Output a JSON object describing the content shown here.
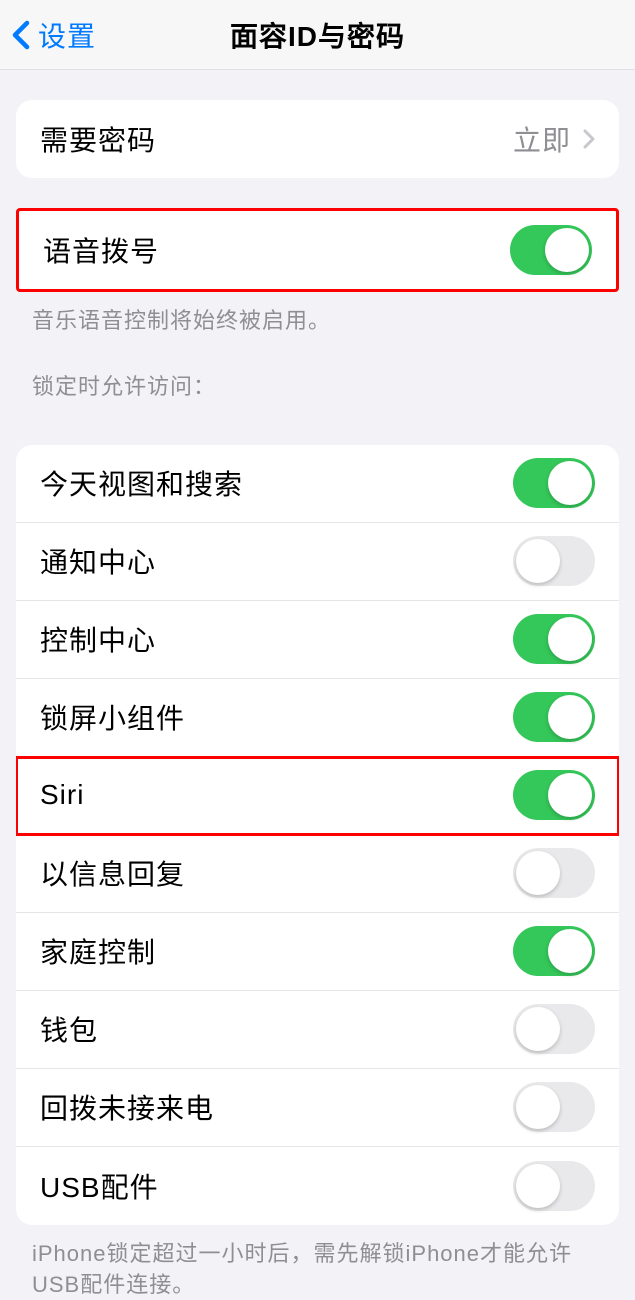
{
  "nav": {
    "back_label": "设置",
    "title": "面容ID与密码"
  },
  "require_passcode": {
    "label": "需要密码",
    "value": "立即"
  },
  "voice_dial": {
    "label": "语音拨号",
    "enabled": true
  },
  "voice_dial_footer": "音乐语音控制将始终被启用。",
  "lock_access_header": "锁定时允许访问：",
  "lock_access_items": [
    {
      "label": "今天视图和搜索",
      "enabled": true
    },
    {
      "label": "通知中心",
      "enabled": false
    },
    {
      "label": "控制中心",
      "enabled": true
    },
    {
      "label": "锁屏小组件",
      "enabled": true
    },
    {
      "label": "Siri",
      "enabled": true
    },
    {
      "label": "以信息回复",
      "enabled": false
    },
    {
      "label": "家庭控制",
      "enabled": true
    },
    {
      "label": "钱包",
      "enabled": false
    },
    {
      "label": "回拨未接来电",
      "enabled": false
    },
    {
      "label": "USB配件",
      "enabled": false
    }
  ],
  "usb_footer": "iPhone锁定超过一小时后，需先解锁iPhone才能允许USB配件连接。",
  "highlights": {
    "voice_dial_group": true,
    "siri_row_index": 4
  }
}
